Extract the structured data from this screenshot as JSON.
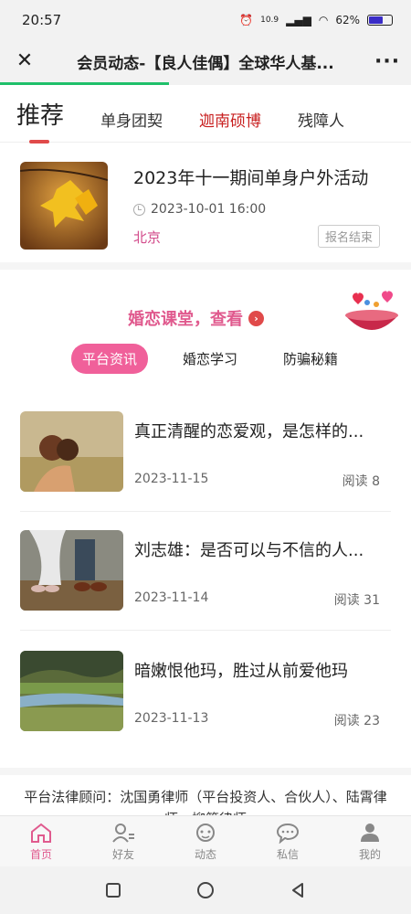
{
  "status_bar": {
    "time": "20:57",
    "net_speed": "10.9",
    "battery": "62%",
    "battery_level": 0.62
  },
  "header": {
    "title": "会员动态-【良人佳偶】全球华人基..."
  },
  "page_load_progress": 0.41,
  "tabs": [
    {
      "label": "推荐"
    },
    {
      "label": "单身团契"
    },
    {
      "label": "迦南硕博"
    },
    {
      "label": "残障人"
    }
  ],
  "event": {
    "title": "2023年十一期间单身户外活动",
    "time": "2023-10-01 16:00",
    "city": "北京",
    "status": "报名结束"
  },
  "course": {
    "title": "婚恋课堂，查看",
    "subtabs": [
      {
        "label": "平台资讯"
      },
      {
        "label": "婚恋学习"
      },
      {
        "label": "防骗秘籍"
      }
    ]
  },
  "articles": [
    {
      "title": "真正清醒的恋爱观，是怎样的...",
      "date": "2023-11-15",
      "reads": "阅读 8"
    },
    {
      "title": "刘志雄：是否可以与不信的人...",
      "date": "2023-11-14",
      "reads": "阅读 31"
    },
    {
      "title": "暗嫩恨他玛，胜过从前爱他玛",
      "date": "2023-11-13",
      "reads": "阅读 23"
    }
  ],
  "legal": "平台法律顾问：沈国勇律师（平台投资人、合伙人）、陆霄律师、柳箐律师",
  "bottom_nav": [
    {
      "label": "首页",
      "icon": "home-icon"
    },
    {
      "label": "好友",
      "icon": "friends-icon"
    },
    {
      "label": "动态",
      "icon": "moments-icon"
    },
    {
      "label": "私信",
      "icon": "message-icon"
    },
    {
      "label": "我的",
      "icon": "profile-icon"
    }
  ],
  "colors": {
    "accent": "#e05a8e",
    "tab_red": "#c82020",
    "progress": "#1fc06a"
  }
}
